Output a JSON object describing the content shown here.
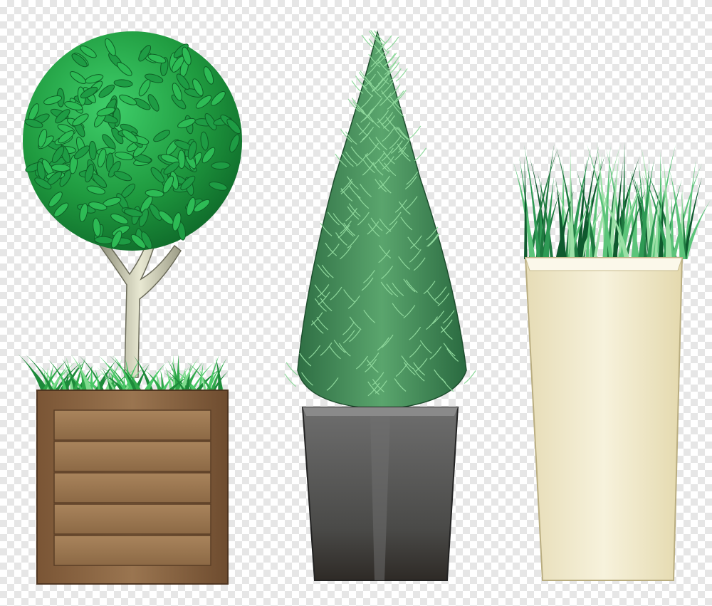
{
  "scene": {
    "background": "transparency-checkerboard",
    "plants": [
      {
        "name": "topiary-ball-tree",
        "container": "wooden-crate-planter",
        "foliage_color": "#1f9a3f",
        "container_color": "#8a6540"
      },
      {
        "name": "cypress-cone-shrub",
        "container": "dark-gray-square-pot",
        "foliage_color": "#3f8a55",
        "container_color": "#5d5d5d"
      },
      {
        "name": "ornamental-grass",
        "container": "cream-tall-planter",
        "foliage_color": "#2f8f4e",
        "container_color": "#f2ecd0"
      }
    ]
  }
}
